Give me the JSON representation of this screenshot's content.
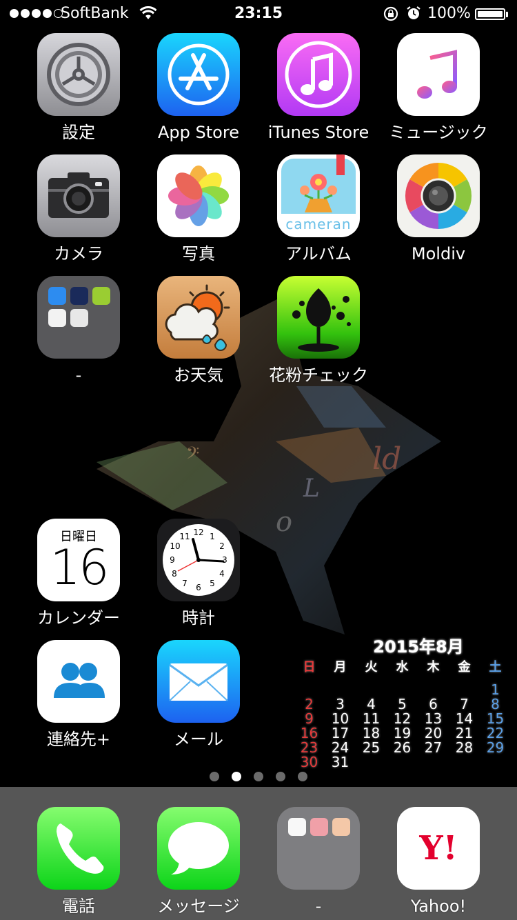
{
  "status": {
    "carrier": "SoftBank",
    "time": "23:15",
    "battery": "100%"
  },
  "apps": {
    "settings": "設定",
    "appstore": "App Store",
    "itunes": "iTunes Store",
    "music": "ミュージック",
    "camera": "カメラ",
    "photos": "写真",
    "album": "アルバム",
    "moldiv": "Moldiv",
    "folder1": "-",
    "tenki": "お天気",
    "kafun": "花粉チェック",
    "calendar": "カレンダー",
    "clock": "時計",
    "contacts": "連絡先+",
    "mail": "メール"
  },
  "calendar_icon": {
    "weekday": "日曜日",
    "date": "16"
  },
  "album_icon_text": "cameran",
  "dock": {
    "phone": "電話",
    "messages": "メッセージ",
    "folder2": "-",
    "yahoo": "Yahoo!"
  },
  "page_indicator": {
    "pages": 5,
    "current": 2
  },
  "wallpaper_calendar": {
    "title": "2015年8月",
    "weekdays": [
      "日",
      "月",
      "火",
      "水",
      "木",
      "金",
      "土"
    ],
    "weeks": [
      [
        "",
        "",
        "",
        "",
        "",
        "",
        "1"
      ],
      [
        "2",
        "3",
        "4",
        "5",
        "6",
        "7",
        "8"
      ],
      [
        "9",
        "10",
        "11",
        "12",
        "13",
        "14",
        "15"
      ],
      [
        "16",
        "17",
        "18",
        "19",
        "20",
        "21",
        "22"
      ],
      [
        "23",
        "24",
        "25",
        "26",
        "27",
        "28",
        "29"
      ],
      [
        "30",
        "31",
        "",
        "",
        "",
        "",
        ""
      ]
    ]
  },
  "colors": {
    "sunday": "#e83a3a",
    "saturday": "#5aa0e8",
    "dock_bg": "#6e6e6e"
  }
}
